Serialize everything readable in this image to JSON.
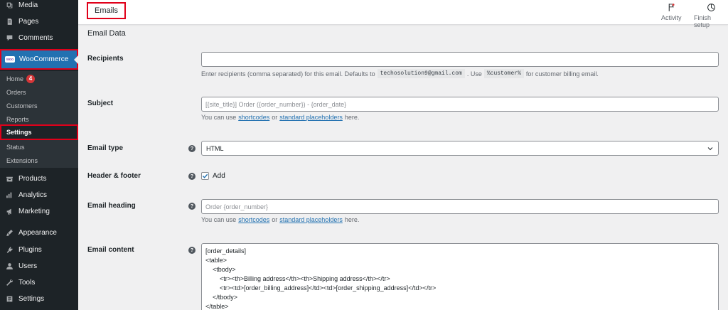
{
  "sidebar": {
    "top_items": [
      {
        "label": "Media",
        "icon": "media-icon"
      },
      {
        "label": "Pages",
        "icon": "pages-icon"
      },
      {
        "label": "Comments",
        "icon": "comments-icon"
      }
    ],
    "woocommerce": {
      "label": "WooCommerce",
      "logo_text": "woo",
      "icon": "woocommerce-icon"
    },
    "submenu": [
      {
        "label": "Home",
        "badge": "4"
      },
      {
        "label": "Orders"
      },
      {
        "label": "Customers"
      },
      {
        "label": "Reports"
      },
      {
        "label": "Settings",
        "active": true
      },
      {
        "label": "Status"
      },
      {
        "label": "Extensions"
      }
    ],
    "bottom_items": [
      {
        "label": "Products",
        "icon": "products-icon"
      },
      {
        "label": "Analytics",
        "icon": "analytics-icon"
      },
      {
        "label": "Marketing",
        "icon": "marketing-icon"
      },
      {
        "label": "Appearance",
        "icon": "appearance-icon"
      },
      {
        "label": "Plugins",
        "icon": "plugins-icon"
      },
      {
        "label": "Users",
        "icon": "users-icon"
      },
      {
        "label": "Tools",
        "icon": "tools-icon"
      },
      {
        "label": "Settings",
        "icon": "settings-icon"
      }
    ]
  },
  "header": {
    "title": "Emails",
    "actions": [
      {
        "label": "Activity",
        "icon": "flag-icon"
      },
      {
        "label": "Finish setup",
        "icon": "progress-icon"
      }
    ]
  },
  "form": {
    "section_title": "Email Data",
    "recipients": {
      "label": "Recipients",
      "value": "",
      "desc_before": "Enter recipients (comma separated) for this email. Defaults to",
      "desc_code1": "techosolution9@gmail.com",
      "desc_mid": ". Use",
      "desc_code2": "%customer%",
      "desc_after": "for customer billing email."
    },
    "subject": {
      "label": "Subject",
      "placeholder": "[{site_title}] Order ({order_number}) - {order_date}",
      "desc_before": "You can use",
      "link1": "shortcodes",
      "desc_mid": "or",
      "link2": "standard placeholders",
      "desc_after": "here."
    },
    "email_type": {
      "label": "Email type",
      "value": "HTML"
    },
    "header_footer": {
      "label": "Header & footer",
      "checkbox_label": "Add",
      "checked": true
    },
    "email_heading": {
      "label": "Email heading",
      "placeholder": "Order {order_number}",
      "desc_before": "You can use",
      "link1": "shortcodes",
      "desc_mid": "or",
      "link2": "standard placeholders",
      "desc_after": "here."
    },
    "email_content": {
      "label": "Email content",
      "lines": [
        "[order_details]",
        "<table>",
        "    <tbody>",
        "        <tr><th>Billing address</th><th>Shipping address</th></tr>",
        "        <tr><td>[order_billing_address]</td><td>[order_shipping_address]</td></tr>",
        "    </tbody>",
        "</table>"
      ]
    },
    "help_glyph": "?"
  },
  "colors": {
    "sidebar_bg": "#1d2327",
    "accent": "#2271b1",
    "highlight_border": "#e0001a",
    "badge": "#d63638"
  }
}
